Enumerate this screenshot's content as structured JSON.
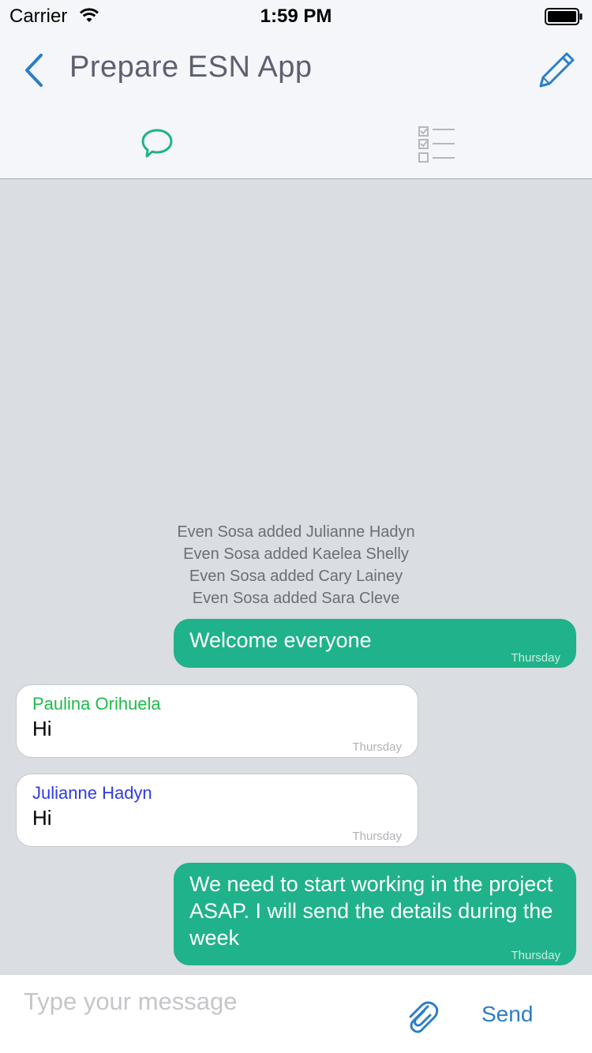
{
  "status_bar": {
    "carrier": "Carrier",
    "time": "1:59 PM",
    "wifi_icon": "wifi-icon",
    "battery_icon": "battery-icon"
  },
  "nav": {
    "title": "Prepare ESN App",
    "back_icon": "chevron-left-icon",
    "edit_icon": "pencil-icon"
  },
  "tabs": [
    {
      "icon": "chat-bubble-icon",
      "active": true
    },
    {
      "icon": "checklist-icon",
      "active": false
    }
  ],
  "system_messages": [
    "Even Sosa added Julianne Hadyn",
    "Even Sosa added Kaelea Shelly",
    "Even Sosa added Cary Lainey",
    "Even Sosa added Sara Cleve"
  ],
  "messages": [
    {
      "direction": "out",
      "text": "Welcome everyone",
      "time": "Thursday"
    },
    {
      "direction": "in",
      "sender": "Paulina Orihuela",
      "sender_color": "#1fbb4a",
      "text": "Hi",
      "time": "Thursday"
    },
    {
      "direction": "in",
      "sender": "Julianne Hadyn",
      "sender_color": "#2f3be6",
      "text": "Hi",
      "time": "Thursday"
    },
    {
      "direction": "out",
      "text": "We need to start working in the project ASAP. I will send the details during the week",
      "time": "Thursday"
    }
  ],
  "composer": {
    "placeholder": "Type your message",
    "attach_icon": "paperclip-icon",
    "send_label": "Send"
  },
  "colors": {
    "accent": "#20b28a",
    "link": "#2a7ec8"
  }
}
